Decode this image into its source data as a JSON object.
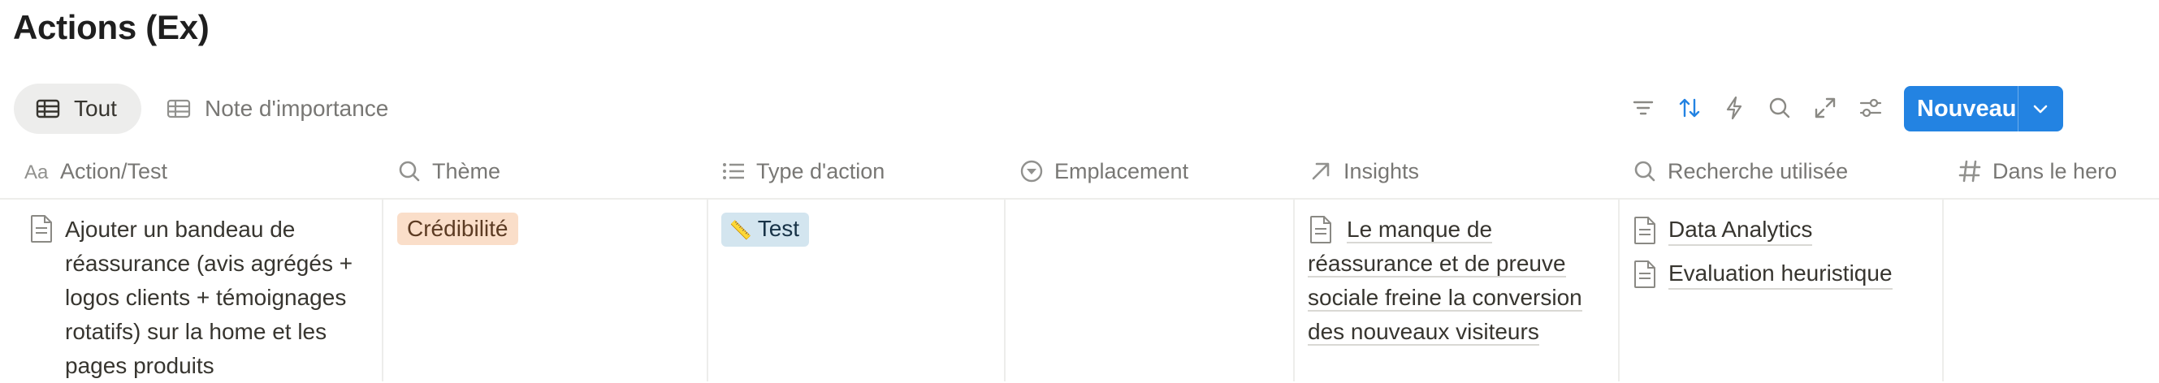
{
  "page": {
    "title": "Actions (Ex)"
  },
  "views": [
    {
      "label": "Tout",
      "icon": "table-icon",
      "active": true
    },
    {
      "label": "Note d'importance",
      "icon": "table-icon",
      "active": false
    }
  ],
  "toolbar": {
    "icons": [
      "filter-icon",
      "sort-icon",
      "automation-icon",
      "search-icon",
      "expand-icon",
      "settings-icon"
    ],
    "new_label": "Nouveau",
    "accent": "#2383e2"
  },
  "columns": [
    {
      "label": "Action/Test",
      "icon": "text-type-icon"
    },
    {
      "label": "Thème",
      "icon": "search-icon"
    },
    {
      "label": "Type d'action",
      "icon": "list-icon"
    },
    {
      "label": "Emplacement",
      "icon": "select-icon"
    },
    {
      "label": "Insights",
      "icon": "relation-arrow-icon"
    },
    {
      "label": "Recherche utilisée",
      "icon": "search-icon"
    },
    {
      "label": "Dans le hero",
      "icon": "hash-icon"
    }
  ],
  "rows": [
    {
      "action": "Ajouter un bandeau de réassurance (avis agrégés + logos clients + témoignages rotatifs) sur la home et les pages produits",
      "theme": {
        "label": "Crédibilité",
        "color": "#fadec9"
      },
      "type": {
        "emoji": "📏",
        "label": "Test",
        "color": "#d3e5ef"
      },
      "emplacement": "",
      "insight": "Le manque de réassurance et de preuve sociale freine la conversion des nouveaux visiteurs",
      "recherche": [
        "Data Analytics",
        "Evaluation heuristique"
      ],
      "hero": ""
    }
  ]
}
